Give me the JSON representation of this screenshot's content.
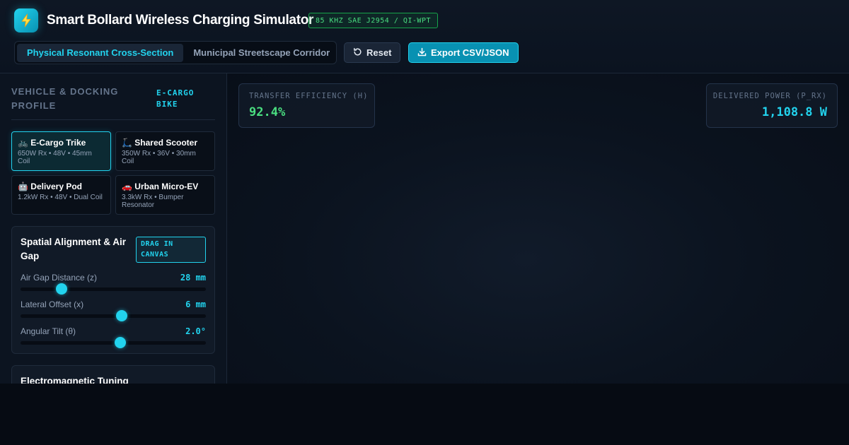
{
  "header": {
    "title": "Smart Bollard Wireless Charging Simulator",
    "standard_badge": "85 KHZ SAE J2954 / QI-WPT",
    "logo_icon": "lightning-bolt-icon",
    "tabs": [
      {
        "label": "Physical Resonant Cross-Section",
        "active": true
      },
      {
        "label": "Municipal Streetscape Corridor",
        "active": false
      }
    ],
    "reset_label": "Reset",
    "export_label": "Export CSV/JSON"
  },
  "sidebar": {
    "section_title": "Vehicle & Docking Profile",
    "section_tag": "E-CARGO BIKE",
    "vehicles": [
      {
        "icon": "🚲",
        "name": "E-Cargo Trike",
        "spec": "650W Rx • 48V • 45mm Coil",
        "active": true
      },
      {
        "icon": "🛴",
        "name": "Shared Scooter",
        "spec": "350W Rx • 36V • 30mm Coil",
        "active": false
      },
      {
        "icon": "🤖",
        "name": "Delivery Pod",
        "spec": "1.2kW Rx • 48V • Dual Coil",
        "active": false
      },
      {
        "icon": "🚗",
        "name": "Urban Micro-EV",
        "spec": "3.3kW Rx • Bumper Resonator",
        "active": false
      }
    ],
    "alignment": {
      "title": "Spatial Alignment & Air Gap",
      "badge": "DRAG IN CANVAS",
      "sliders": [
        {
          "label": "Air Gap Distance (z)",
          "value": "28 mm",
          "fraction": 0.22
        },
        {
          "label": "Lateral Offset (x)",
          "value": "6 mm",
          "fraction": 0.545
        },
        {
          "label": "Angular Tilt (θ)",
          "value": "2.0°",
          "fraction": 0.538
        }
      ]
    },
    "tuning": {
      "title": "Electromagnetic Tuning"
    }
  },
  "metrics": {
    "efficiency_label": "TRANSFER EFFICIENCY (Η)",
    "efficiency_value": "92.4%",
    "power_label": "DELIVERED POWER (P_RX)",
    "power_value": "1,108.8 W"
  },
  "colors": {
    "accent": "#22d3ee",
    "success": "#4ade80",
    "background": "#0a111c"
  }
}
